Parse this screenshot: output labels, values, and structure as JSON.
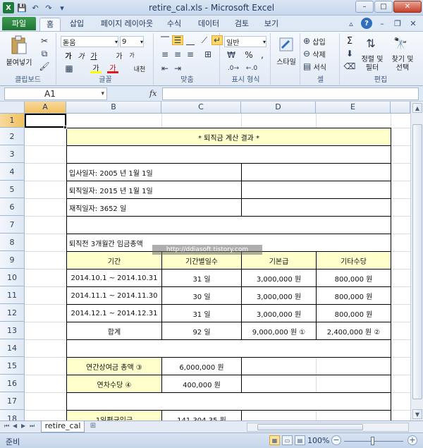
{
  "window": {
    "title": "retire_cal.xls - Microsoft Excel",
    "app_icon": "X",
    "minimize": "–",
    "maximize": "□",
    "close": "✕"
  },
  "qat": {
    "save_icon": "💾",
    "undo_icon": "↶",
    "redo_icon": "↷",
    "customize_icon": "▾"
  },
  "tabs": {
    "file": "파일",
    "items": [
      "홈",
      "삽입",
      "페이지 레이아웃",
      "수식",
      "데이터",
      "검토",
      "보기"
    ]
  },
  "ribbon": {
    "clipboard": {
      "paste": "붙여넣기",
      "label": "클립보드"
    },
    "font": {
      "name": "돋움",
      "size": "9",
      "label": "글꼴",
      "bold": "가",
      "italic": "가",
      "underline": "가",
      "grow": "가",
      "shrink": "가",
      "fill_color": "가",
      "font_color": "가",
      "phonetic": "내천"
    },
    "alignment": {
      "label": "맞춤"
    },
    "number": {
      "format": "일반",
      "percent": "%",
      "comma": ",",
      "label": "표시 형식"
    },
    "styles": {
      "button": "스타일"
    },
    "cells": {
      "insert": "삽입",
      "delete": "삭제",
      "format": "서식",
      "label": "셀"
    },
    "editing": {
      "sort": "정렬 및 필터",
      "find": "찾기 및 선택",
      "label": "편집",
      "sum": "Σ"
    }
  },
  "formula_bar": {
    "name_box": "A1",
    "fx": "fx",
    "value": ""
  },
  "columns": [
    "A",
    "B",
    "C",
    "D",
    "E"
  ],
  "rows": [
    "1",
    "2",
    "3",
    "4",
    "5",
    "6",
    "7",
    "8",
    "9",
    "10",
    "11",
    "12",
    "13",
    "14",
    "15",
    "16",
    "17",
    "18"
  ],
  "sheet": {
    "title": "* 퇴직금 계산 결과 *",
    "hire_date": "입사일자: 2005 년 1월 1일",
    "retire_date": "퇴직일자: 2015 년 1월 1일",
    "service_days": "재직일자: 3652 일",
    "wage_total_label": "퇴직전 3개월간 임금총액",
    "table_header": [
      "기간",
      "기간별일수",
      "기본급",
      "기타수당"
    ],
    "table_rows": [
      [
        "2014.10.1 ~ 2014.10.31",
        "31 일",
        "3,000,000 원",
        "800,000 원"
      ],
      [
        "2014.11.1 ~ 2014.11.30",
        "30 일",
        "3,000,000 원",
        "800,000 원"
      ],
      [
        "2014.12.1 ~ 2014.12.31",
        "31 일",
        "3,000,000 원",
        "800,000 원"
      ]
    ],
    "total_row": [
      "합계",
      "92 일",
      "9,000,000 원 ①",
      "2,400,000 원 ②"
    ],
    "annual_bonus_label": "연간상여금 총액 ③",
    "annual_bonus_value": "6,000,000 원",
    "annual_leave_label": "연차수당 ④",
    "annual_leave_value": "400,000 원",
    "daily_wage_label": "1일평균임금",
    "daily_wage_value": "141,304.35 원"
  },
  "watermark": "http://ddiasoft.tistory.com",
  "sheet_tabs": {
    "active": "retire_cal"
  },
  "status": {
    "ready": "준비",
    "zoom": "100%"
  }
}
